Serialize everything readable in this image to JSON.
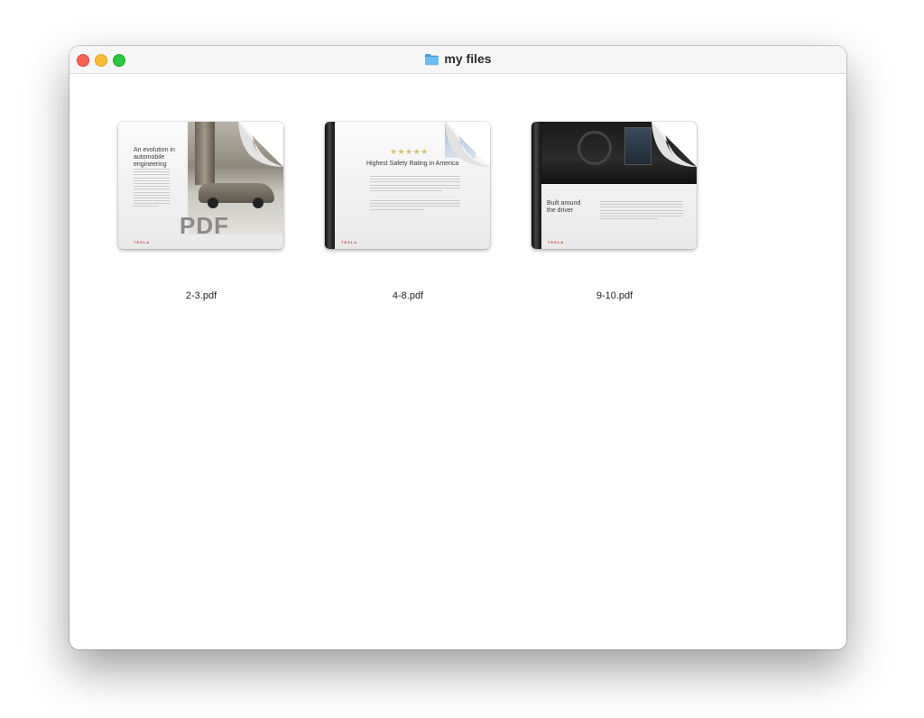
{
  "window": {
    "title": "my files",
    "folder_icon": "folder-icon"
  },
  "files": [
    {
      "name": "2-3.pdf",
      "preview_heading": "An evolution in automobile engineering",
      "preview_badge": "PDF",
      "brand": "TESLA"
    },
    {
      "name": "4-8.pdf",
      "preview_rating": "★★★★★",
      "preview_heading": "Highest Safety Rating in America",
      "brand": "TESLA"
    },
    {
      "name": "9-10.pdf",
      "preview_heading": "Built around the driver",
      "brand": "TESLA"
    }
  ],
  "colors": {
    "close": "#fe5f57",
    "minimize": "#febc2e",
    "maximize": "#28c840",
    "folder": "#5fb4f0"
  }
}
